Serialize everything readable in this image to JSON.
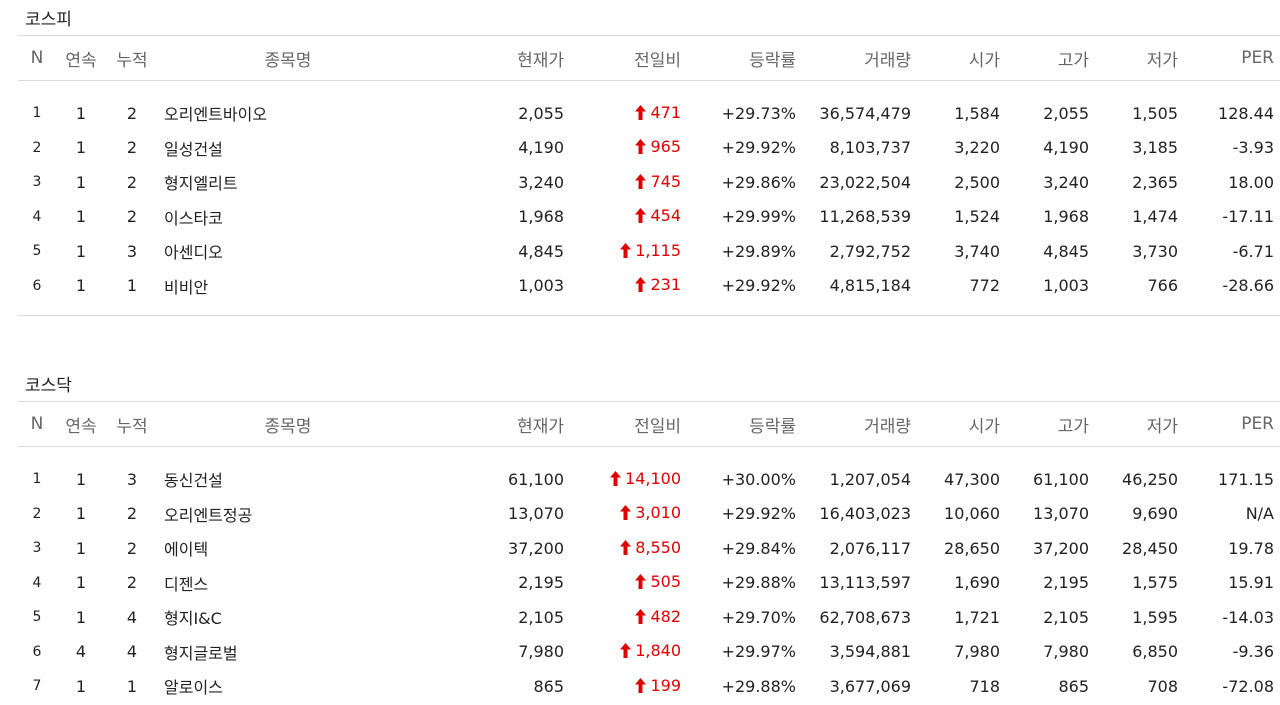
{
  "headers": {
    "n": "N",
    "streak": "연속",
    "cumulative": "누적",
    "name": "종목명",
    "price": "현재가",
    "change": "전일비",
    "rate": "등락률",
    "volume": "거래량",
    "open": "시가",
    "high": "고가",
    "low": "저가",
    "per": "PER"
  },
  "colors": {
    "up": "#e00000",
    "header_text": "#666666",
    "border": "#d9d9d9"
  },
  "icons": {
    "up_arrow": "up-arrow-icon"
  },
  "kospi": {
    "title": "코스피",
    "rows": [
      {
        "n": "1",
        "streak": "1",
        "cumulative": "2",
        "name": "오리엔트바이오",
        "price": "2,055",
        "change": "471",
        "rate": "+29.73%",
        "volume": "36,574,479",
        "open": "1,584",
        "high": "2,055",
        "low": "1,505",
        "per": "128.44"
      },
      {
        "n": "2",
        "streak": "1",
        "cumulative": "2",
        "name": "일성건설",
        "price": "4,190",
        "change": "965",
        "rate": "+29.92%",
        "volume": "8,103,737",
        "open": "3,220",
        "high": "4,190",
        "low": "3,185",
        "per": "-3.93"
      },
      {
        "n": "3",
        "streak": "1",
        "cumulative": "2",
        "name": "형지엘리트",
        "price": "3,240",
        "change": "745",
        "rate": "+29.86%",
        "volume": "23,022,504",
        "open": "2,500",
        "high": "3,240",
        "low": "2,365",
        "per": "18.00"
      },
      {
        "n": "4",
        "streak": "1",
        "cumulative": "2",
        "name": "이스타코",
        "price": "1,968",
        "change": "454",
        "rate": "+29.99%",
        "volume": "11,268,539",
        "open": "1,524",
        "high": "1,968",
        "low": "1,474",
        "per": "-17.11"
      },
      {
        "n": "5",
        "streak": "1",
        "cumulative": "3",
        "name": "아센디오",
        "price": "4,845",
        "change": "1,115",
        "rate": "+29.89%",
        "volume": "2,792,752",
        "open": "3,740",
        "high": "4,845",
        "low": "3,730",
        "per": "-6.71"
      },
      {
        "n": "6",
        "streak": "1",
        "cumulative": "1",
        "name": "비비안",
        "price": "1,003",
        "change": "231",
        "rate": "+29.92%",
        "volume": "4,815,184",
        "open": "772",
        "high": "1,003",
        "low": "766",
        "per": "-28.66"
      }
    ]
  },
  "kosdaq": {
    "title": "코스닥",
    "rows": [
      {
        "n": "1",
        "streak": "1",
        "cumulative": "3",
        "name": "동신건설",
        "price": "61,100",
        "change": "14,100",
        "rate": "+30.00%",
        "volume": "1,207,054",
        "open": "47,300",
        "high": "61,100",
        "low": "46,250",
        "per": "171.15"
      },
      {
        "n": "2",
        "streak": "1",
        "cumulative": "2",
        "name": "오리엔트정공",
        "price": "13,070",
        "change": "3,010",
        "rate": "+29.92%",
        "volume": "16,403,023",
        "open": "10,060",
        "high": "13,070",
        "low": "9,690",
        "per": "N/A"
      },
      {
        "n": "3",
        "streak": "1",
        "cumulative": "2",
        "name": "에이텍",
        "price": "37,200",
        "change": "8,550",
        "rate": "+29.84%",
        "volume": "2,076,117",
        "open": "28,650",
        "high": "37,200",
        "low": "28,450",
        "per": "19.78"
      },
      {
        "n": "4",
        "streak": "1",
        "cumulative": "2",
        "name": "디젠스",
        "price": "2,195",
        "change": "505",
        "rate": "+29.88%",
        "volume": "13,113,597",
        "open": "1,690",
        "high": "2,195",
        "low": "1,575",
        "per": "15.91"
      },
      {
        "n": "5",
        "streak": "1",
        "cumulative": "4",
        "name": "형지I&C",
        "price": "2,105",
        "change": "482",
        "rate": "+29.70%",
        "volume": "62,708,673",
        "open": "1,721",
        "high": "2,105",
        "low": "1,595",
        "per": "-14.03"
      },
      {
        "n": "6",
        "streak": "4",
        "cumulative": "4",
        "name": "형지글로벌",
        "price": "7,980",
        "change": "1,840",
        "rate": "+29.97%",
        "volume": "3,594,881",
        "open": "7,980",
        "high": "7,980",
        "low": "6,850",
        "per": "-9.36"
      },
      {
        "n": "7",
        "streak": "1",
        "cumulative": "1",
        "name": "알로이스",
        "price": "865",
        "change": "199",
        "rate": "+29.88%",
        "volume": "3,677,069",
        "open": "718",
        "high": "865",
        "low": "708",
        "per": "-72.08"
      }
    ]
  }
}
